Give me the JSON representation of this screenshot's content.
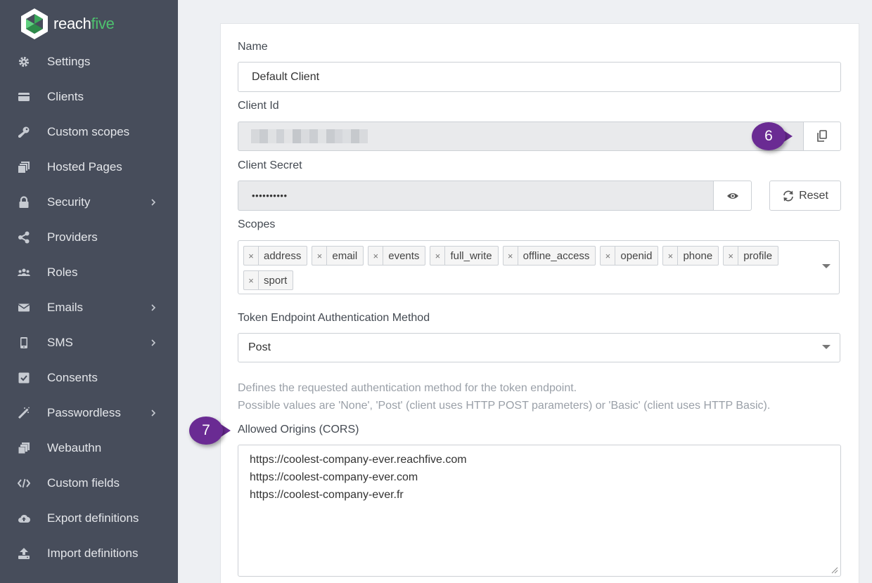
{
  "brand": {
    "prefix": "reach",
    "suffix": "five"
  },
  "sidebar": {
    "items": [
      {
        "label": "Settings",
        "icon": "gear-icon",
        "chevron": false
      },
      {
        "label": "Clients",
        "icon": "card-icon",
        "chevron": false
      },
      {
        "label": "Custom scopes",
        "icon": "key-icon",
        "chevron": false
      },
      {
        "label": "Hosted Pages",
        "icon": "pages-icon",
        "chevron": false
      },
      {
        "label": "Security",
        "icon": "lock-icon",
        "chevron": true
      },
      {
        "label": "Providers",
        "icon": "share-icon",
        "chevron": false
      },
      {
        "label": "Roles",
        "icon": "users-icon",
        "chevron": false
      },
      {
        "label": "Emails",
        "icon": "envelope-icon",
        "chevron": true
      },
      {
        "label": "SMS",
        "icon": "phone-icon",
        "chevron": true
      },
      {
        "label": "Consents",
        "icon": "checkbox-icon",
        "chevron": false
      },
      {
        "label": "Passwordless",
        "icon": "magic-wand-icon",
        "chevron": true
      },
      {
        "label": "Webauthn",
        "icon": "stack-icon",
        "chevron": false
      },
      {
        "label": "Custom fields",
        "icon": "code-icon",
        "chevron": false
      },
      {
        "label": "Export definitions",
        "icon": "cloud-upload-icon",
        "chevron": false
      },
      {
        "label": "Import definitions",
        "icon": "upload-icon",
        "chevron": false
      }
    ]
  },
  "form": {
    "name_label": "Name",
    "name_value": "Default Client",
    "client_id_label": "Client Id",
    "client_secret_label": "Client Secret",
    "client_secret_value": "••••••••••",
    "reset_label": "Reset",
    "scopes_label": "Scopes",
    "scopes": [
      "address",
      "email",
      "events",
      "full_write",
      "offline_access",
      "openid",
      "phone",
      "profile",
      "sport"
    ],
    "token_method_label": "Token Endpoint Authentication Method",
    "token_method_value": "Post",
    "token_help_1": "Defines the requested authentication method for the token endpoint.",
    "token_help_2": "Possible values are 'None', 'Post' (client uses HTTP POST parameters) or 'Basic' (client uses HTTP Basic).",
    "origins_label": "Allowed Origins (CORS)",
    "origins": [
      "https://coolest-company-ever.reachfive.com",
      "https://coolest-company-ever.com",
      "https://coolest-company-ever.fr"
    ]
  },
  "annotations": {
    "callout_6": "6",
    "callout_7": "7"
  },
  "colors": {
    "sidebar_bg": "#474d5b",
    "brand_green": "#4ec26f",
    "callout": "#6a2b93"
  }
}
